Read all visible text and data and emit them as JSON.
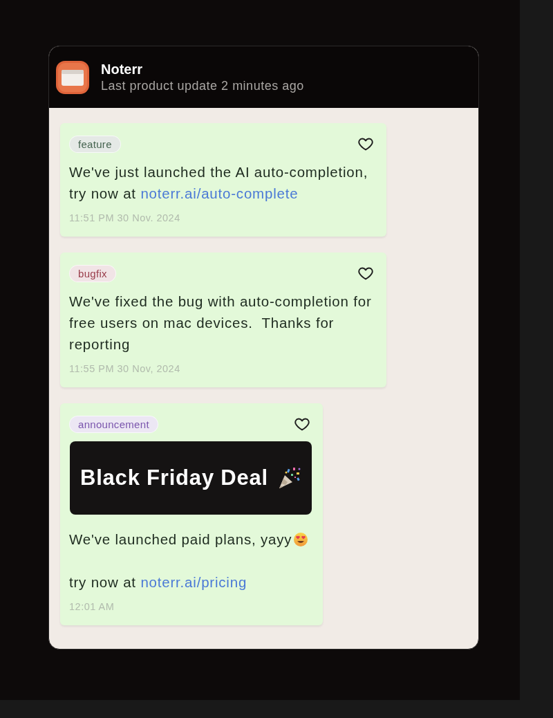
{
  "header": {
    "app_name": "Noterr",
    "subtitle": "Last product update 2 minutes ago"
  },
  "posts": [
    {
      "tag": {
        "label": "feature",
        "color": "#45634f"
      },
      "liked": false,
      "paragraphs": [
        {
          "kind": "link",
          "text": "We've just launched the AI auto-completion, try now at",
          "link": "noterr.ai/auto-complete"
        }
      ],
      "time": "11:51 PM 30 Nov. 2024"
    },
    {
      "tag": {
        "label": "bugfix",
        "color": "#9a3e4c"
      },
      "liked": false,
      "paragraphs": [
        {
          "kind": "plain",
          "text": "We've fixed the bug with auto-completion for free users on mac devices.  Thanks for reporting"
        }
      ],
      "time": "11:55 PM 30 Nov, 2024"
    },
    {
      "tag": {
        "label": "announcement",
        "color": "#7a55ad"
      },
      "liked": false,
      "banner": {
        "text": "Black Friday Deal"
      },
      "paragraphs": [
        {
          "kind": "emoji",
          "text": "We've launched paid plans, yayy"
        },
        {
          "kind": "link",
          "text": "try now at",
          "link": "noterr.ai/pricing"
        }
      ],
      "time": "12:01 AM"
    }
  ]
}
